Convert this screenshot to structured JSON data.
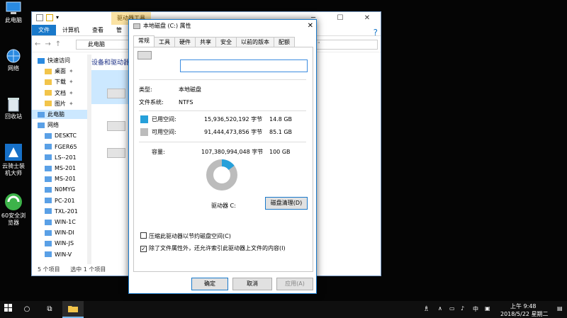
{
  "desktop": {
    "icons": [
      {
        "name": "this-pc",
        "label": "此电脑"
      },
      {
        "name": "network",
        "label": "网络"
      },
      {
        "name": "recycle-bin",
        "label": "回收站"
      },
      {
        "name": "installer",
        "label": "云骑士装机大师"
      },
      {
        "name": "browser",
        "label": "60安全浏览器"
      }
    ]
  },
  "explorer": {
    "context_tab": "驱动器工具",
    "ribbon_tabs": [
      "文件",
      "计算机",
      "查看",
      "管"
    ],
    "path": "此电脑",
    "search_fragment": "\"",
    "nav": [
      {
        "label": "快速访问",
        "pin": false,
        "sel": false
      },
      {
        "label": "桌面",
        "pin": true,
        "sel": false
      },
      {
        "label": "下载",
        "pin": true,
        "sel": false
      },
      {
        "label": "文档",
        "pin": true,
        "sel": false
      },
      {
        "label": "图片",
        "pin": true,
        "sel": false
      },
      {
        "label": "此电脑",
        "pin": false,
        "sel": true
      },
      {
        "label": "网络",
        "pin": false,
        "sel": false
      },
      {
        "label": "DESKTC",
        "pin": false,
        "sel": false
      },
      {
        "label": "FGER65",
        "pin": false,
        "sel": false
      },
      {
        "label": "LS--201",
        "pin": false,
        "sel": false
      },
      {
        "label": "MS-201",
        "pin": false,
        "sel": false
      },
      {
        "label": "MS-201",
        "pin": false,
        "sel": false
      },
      {
        "label": "N0MYG",
        "pin": false,
        "sel": false
      },
      {
        "label": "PC-201",
        "pin": false,
        "sel": false
      },
      {
        "label": "TXL-201",
        "pin": false,
        "sel": false
      },
      {
        "label": "WIN-1C",
        "pin": false,
        "sel": false
      },
      {
        "label": "WIN-DI",
        "pin": false,
        "sel": false
      },
      {
        "label": "WIN-JS",
        "pin": false,
        "sel": false
      },
      {
        "label": "WIN-V",
        "pin": false,
        "sel": false
      }
    ],
    "group_heading": "设备和驱动器",
    "status_items": "5 个项目",
    "status_selected": "选中 1 个项目"
  },
  "dialog": {
    "title": "本地磁盘 (C:) 属性",
    "tabs": [
      "常规",
      "工具",
      "硬件",
      "共享",
      "安全",
      "以前的版本",
      "配额"
    ],
    "name_value": "",
    "type_label": "类型:",
    "type_value": "本地磁盘",
    "fs_label": "文件系统:",
    "fs_value": "NTFS",
    "used_label": "已用空间:",
    "used_bytes": "15,936,520,192 字节",
    "used_size": "14.8 GB",
    "free_label": "可用空间:",
    "free_bytes": "91,444,473,856 字节",
    "free_size": "85.1 GB",
    "cap_label": "容量:",
    "cap_bytes": "107,380,994,048 字节",
    "cap_size": "100 GB",
    "used_fraction": 0.148,
    "drive_label": "驱动器 C:",
    "cleanup_button": "磁盘清理(D)",
    "compress_label": "压缩此驱动器以节约磁盘空间(C)",
    "compress_checked": false,
    "index_label": "除了文件属性外，还允许索引此驱动器上文件的内容(I)",
    "index_checked": true,
    "ok": "确定",
    "cancel": "取消",
    "apply": "应用(A)",
    "colors": {
      "used": "#26a0da",
      "free": "#bcbcbc"
    }
  },
  "taskbar": {
    "ime": "中",
    "time": "上午 9:48",
    "date": "2018/5/22 星期二"
  }
}
